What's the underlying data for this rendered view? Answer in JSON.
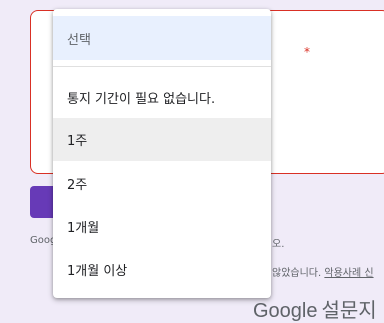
{
  "question": {
    "title_tail": "*"
  },
  "submit": {
    "label": ""
  },
  "footer": {
    "left_text": "Goog",
    "right_top_text": "오.",
    "notice_text": "않았습니다.",
    "report_link": "악용사례 신"
  },
  "brand": {
    "google": "Google",
    "product": "설문지"
  },
  "dropdown": {
    "placeholder": "선택",
    "options": [
      "통지 기간이 필요 없습니다.",
      "1주",
      "2주",
      "1개월",
      "1개월 이상"
    ],
    "highlighted_index": 1
  },
  "colors": {
    "page_background": "#f0ebf8",
    "accent_purple": "#673ab7",
    "error_red": "#d93025",
    "selected_background": "#e8f0fe",
    "hover_background": "#eeeeee"
  }
}
